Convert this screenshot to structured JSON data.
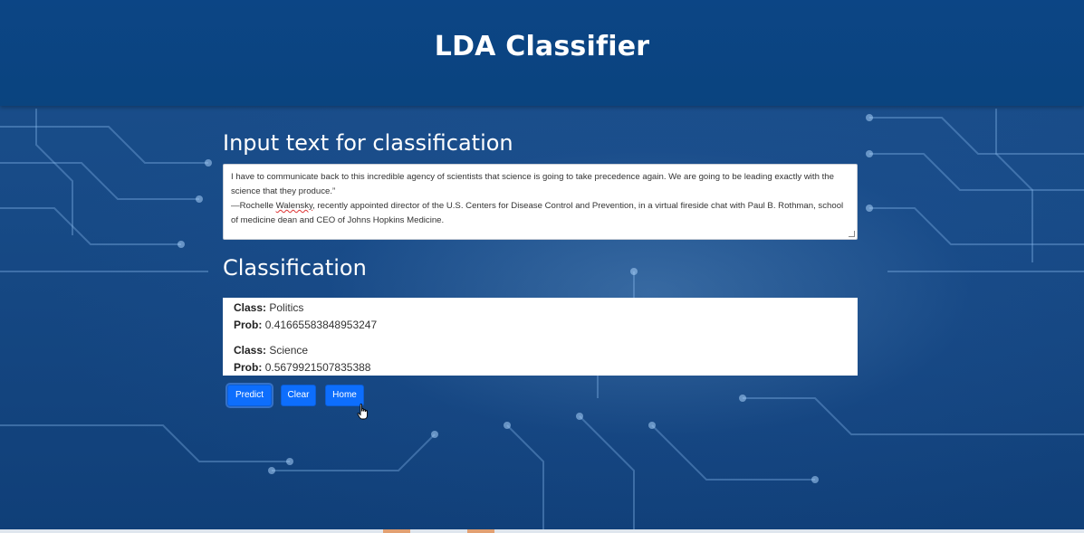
{
  "header": {
    "title": "LDA Classifier"
  },
  "input_section": {
    "title": "Input text for classification",
    "text_line1": "I have to communicate back to this incredible agency of scientists that science is going to take precedence again. We are going to be leading exactly with the science that they produce.”",
    "text_line2_prefix": "—Rochelle ",
    "text_line2_misspelled": "Walensky",
    "text_line2_suffix": ", recently appointed director of the U.S. Centers for Disease Control and Prevention, in a virtual fireside chat with Paul B. Rothman, school of medicine dean and CEO of Johns Hopkins Medicine."
  },
  "classification_section": {
    "title": "Classification",
    "class_label": "Class:",
    "prob_label": "Prob:",
    "results": [
      {
        "class": "Politics",
        "prob": "0.41665583848953247"
      },
      {
        "class": "Science",
        "prob": "0.5679921507835388"
      }
    ]
  },
  "buttons": {
    "predict": "Predict",
    "clear": "Clear",
    "home": "Home"
  },
  "colors": {
    "header_bg": "#0a447f",
    "button_bg": "#0d6efd",
    "page_bg": "#174a86"
  }
}
